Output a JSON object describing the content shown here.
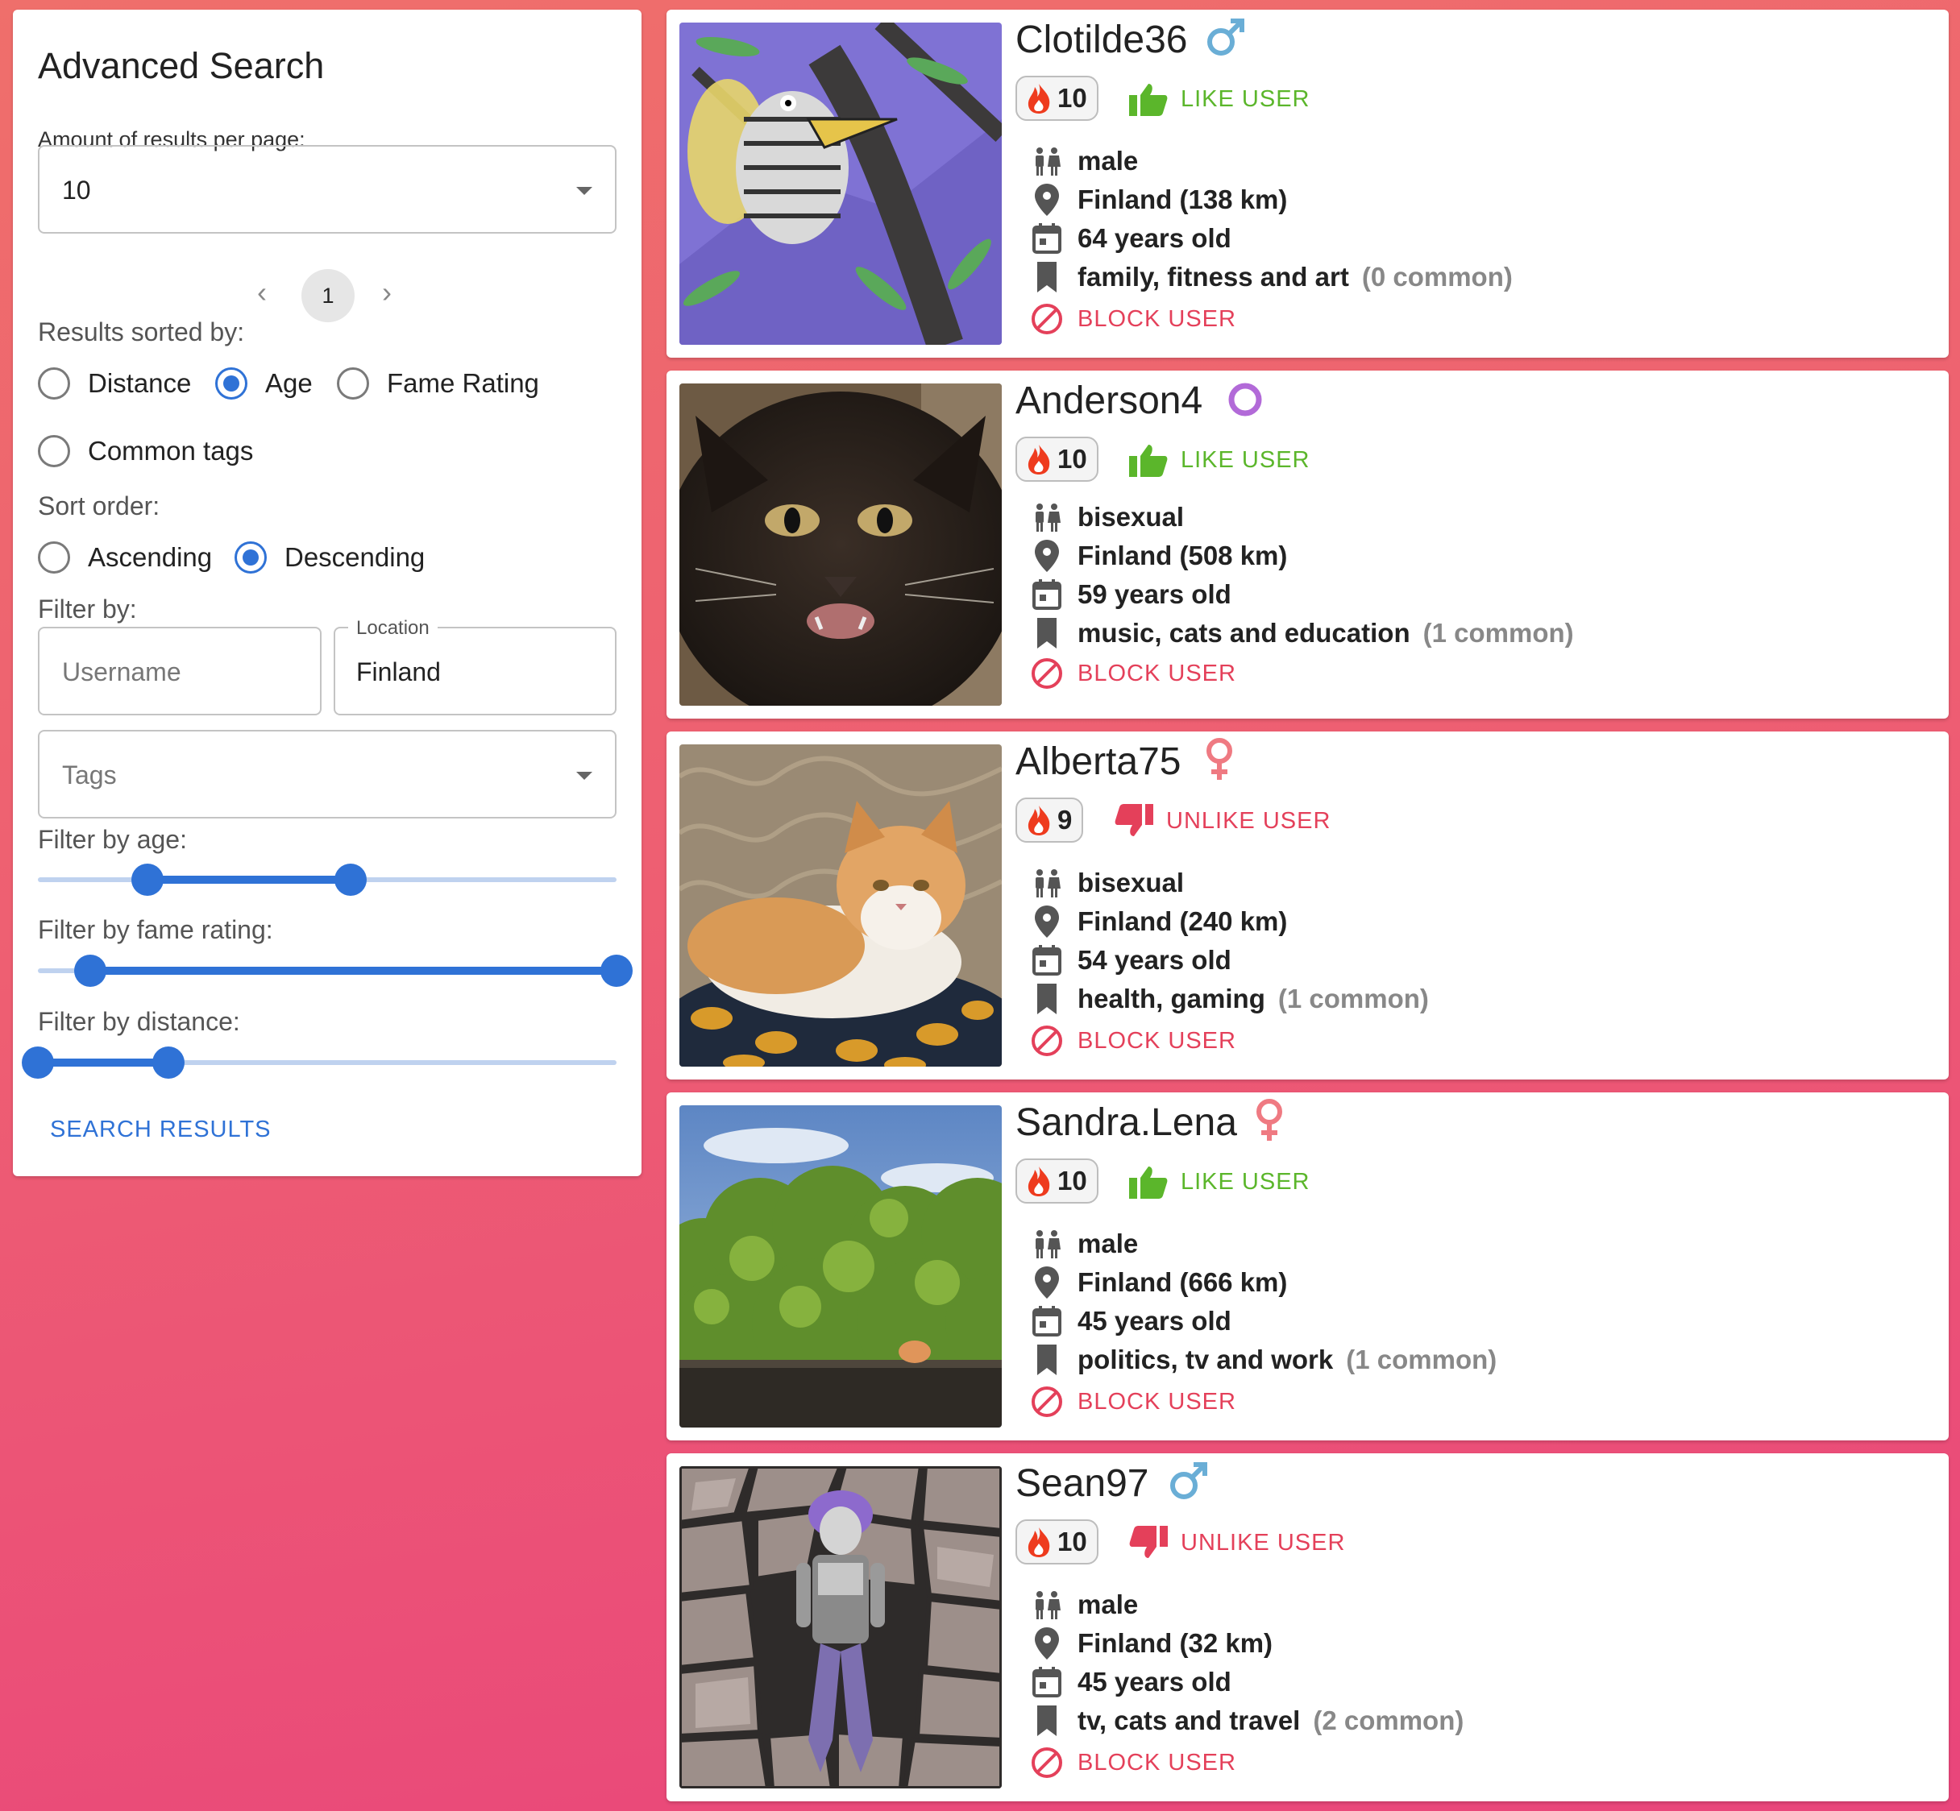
{
  "search": {
    "title": "Advanced Search",
    "per_page_label": "Amount of results per page:",
    "per_page_value": "10",
    "page_current": "1",
    "prev_icon": "chevron-left-icon",
    "next_icon": "chevron-right-icon",
    "sorted_by_label": "Results sorted by:",
    "sort_options": [
      "Distance",
      "Age",
      "Fame Rating",
      "Common tags"
    ],
    "sort_selected": "Age",
    "sort_order_label": "Sort order:",
    "order_options": [
      "Ascending",
      "Descending"
    ],
    "order_selected": "Descending",
    "filter_label": "Filter by:",
    "username_placeholder": "Username",
    "location_label": "Location",
    "location_value": "Finland",
    "tags_placeholder": "Tags",
    "age_label": "Filter by age:",
    "age_range": [
      0.19,
      0.54
    ],
    "fame_label": "Filter by fame rating:",
    "fame_range": [
      0.09,
      1.0
    ],
    "distance_label": "Filter by distance:",
    "distance_range": [
      0.0,
      0.225
    ],
    "search_button": "SEARCH RESULTS"
  },
  "colors": {
    "accent": "#2f72d6",
    "like": "#5bb62b",
    "unlike": "#e4405a",
    "male": "#6aaed6",
    "female": "#ef7a82",
    "other": "#b26ad8"
  },
  "users": [
    {
      "username": "Clotilde36",
      "gender_icon": "male-symbol-icon",
      "fame": "10",
      "action": "LIKE USER",
      "action_type": "like",
      "orientation": "male",
      "location": "Finland (138 km)",
      "age": "64 years old",
      "tags": "family, fitness and art",
      "common": "(0 common)",
      "block": "BLOCK USER"
    },
    {
      "username": "Anderson4",
      "gender_icon": "other-gender-icon",
      "fame": "10",
      "action": "LIKE USER",
      "action_type": "like",
      "orientation": "bisexual",
      "location": "Finland (508 km)",
      "age": "59 years old",
      "tags": "music, cats and education",
      "common": "(1 common)",
      "block": "BLOCK USER"
    },
    {
      "username": "Alberta75",
      "gender_icon": "female-symbol-icon",
      "fame": "9",
      "action": "UNLIKE USER",
      "action_type": "unlike",
      "orientation": "bisexual",
      "location": "Finland (240 km)",
      "age": "54 years old",
      "tags": "health, gaming",
      "common": "(1 common)",
      "block": "BLOCK USER"
    },
    {
      "username": "Sandra.Lena",
      "gender_icon": "female-symbol-icon",
      "fame": "10",
      "action": "LIKE USER",
      "action_type": "like",
      "orientation": "male",
      "location": "Finland (666 km)",
      "age": "45 years old",
      "tags": "politics, tv and work",
      "common": "(1 common)",
      "block": "BLOCK USER"
    },
    {
      "username": "Sean97",
      "gender_icon": "male-symbol-icon",
      "fame": "10",
      "action": "UNLIKE USER",
      "action_type": "unlike",
      "orientation": "male",
      "location": "Finland (32 km)",
      "age": "45 years old",
      "tags": "tv, cats and travel",
      "common": "(2 common)",
      "block": "BLOCK USER"
    }
  ]
}
